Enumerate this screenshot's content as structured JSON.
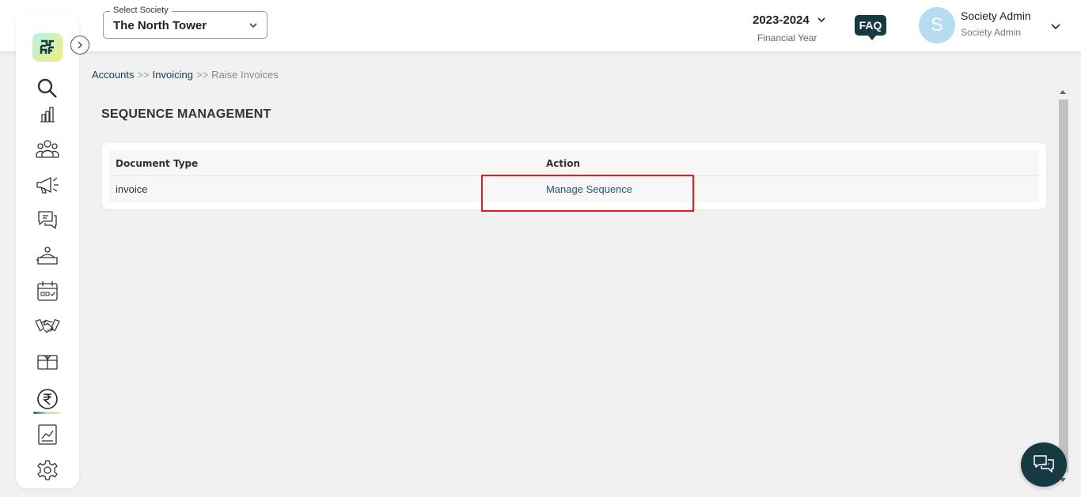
{
  "header": {
    "society_select": {
      "legend": "Select Society",
      "value": "The North Tower"
    },
    "financial_year": {
      "value": "2023-2024",
      "label": "Financial Year"
    },
    "faq_label": "FAQ",
    "user": {
      "initial": "S",
      "name": "Society Admin",
      "role": "Society Admin"
    }
  },
  "sidebar": {
    "items": [
      {
        "icon": "search-icon"
      },
      {
        "icon": "bar-chart-icon"
      },
      {
        "icon": "users-icon"
      },
      {
        "icon": "megaphone-icon"
      },
      {
        "icon": "chat-bubbles-icon"
      },
      {
        "icon": "helpdesk-icon"
      },
      {
        "icon": "calendar-icon"
      },
      {
        "icon": "handshake-icon"
      },
      {
        "icon": "parcel-icon"
      },
      {
        "icon": "rupee-icon",
        "active": true
      },
      {
        "icon": "report-chart-icon"
      },
      {
        "icon": "gear-icon"
      }
    ]
  },
  "breadcrumb": {
    "items": [
      "Accounts",
      "Invoicing",
      "Raise Invoices"
    ],
    "separator": ">>"
  },
  "page_title": "SEQUENCE MANAGEMENT",
  "table": {
    "columns": [
      "Document Type",
      "Action"
    ],
    "rows": [
      {
        "document_type": "invoice",
        "action": "Manage Sequence"
      }
    ]
  },
  "colors": {
    "brand_dark": "#163a42",
    "link": "#1a5a8a",
    "highlight": "#e02020"
  }
}
